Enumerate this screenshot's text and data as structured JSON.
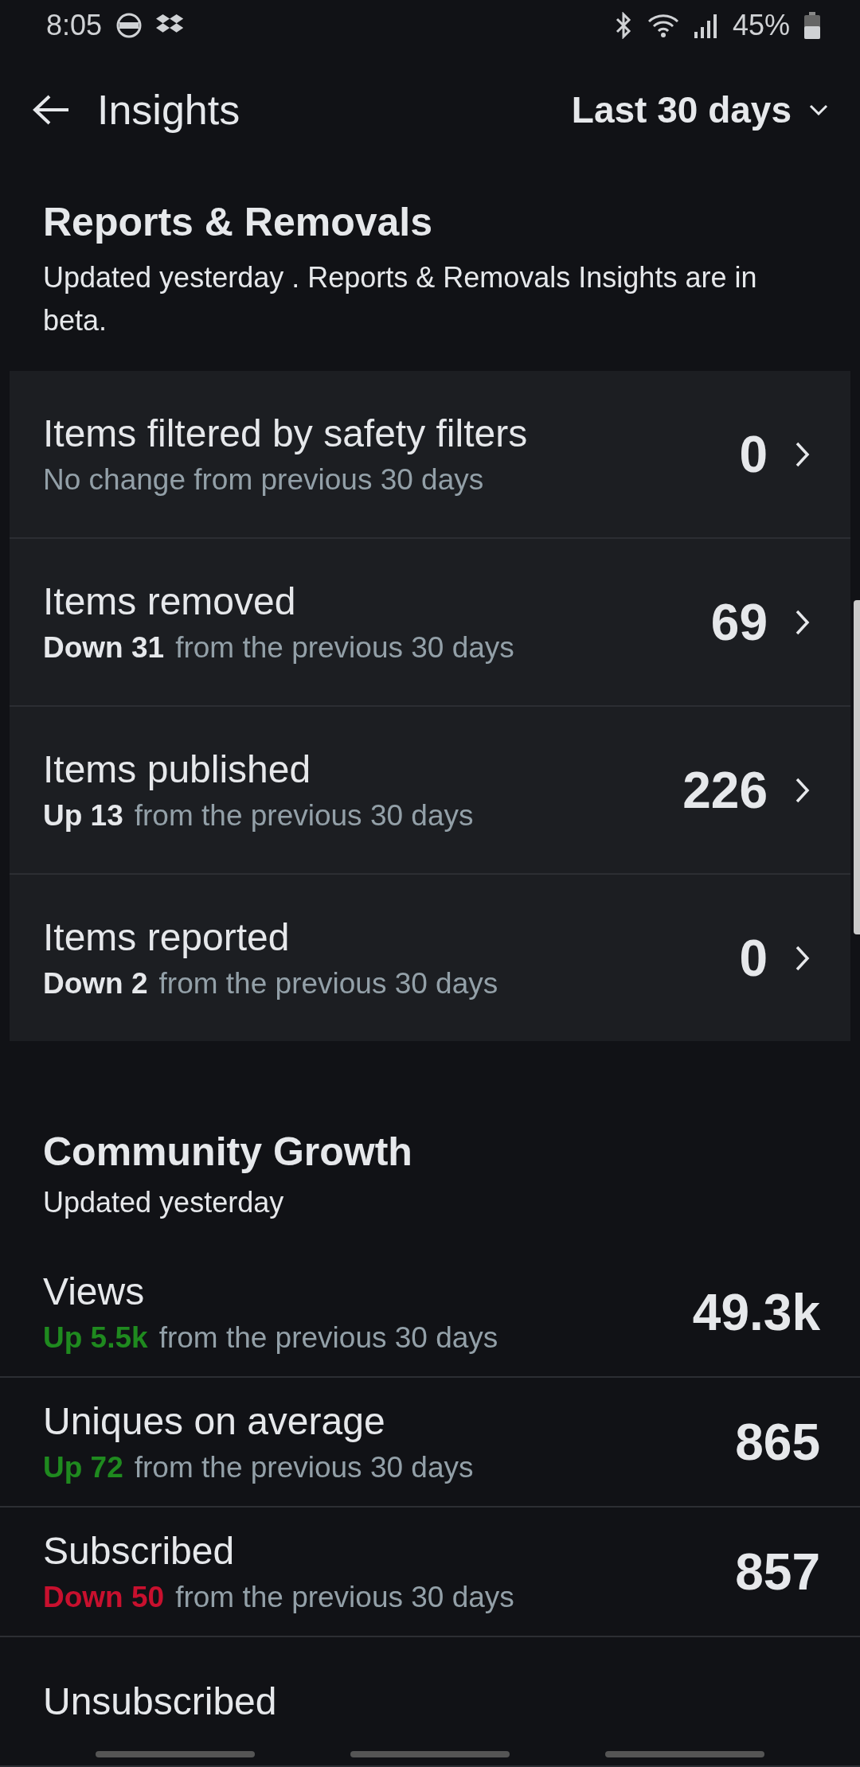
{
  "status_bar": {
    "time": "8:05",
    "battery": "45%"
  },
  "header": {
    "title": "Insights",
    "range": "Last 30 days"
  },
  "reports": {
    "title": "Reports & Removals",
    "subtitle": "Updated yesterday . Reports & Removals Insights are in beta.",
    "rows": [
      {
        "label": "Items filtered by safety filters",
        "note": "No change from previous 30 days",
        "value": "0"
      },
      {
        "label": "Items removed",
        "delta": "Down 31",
        "note": "from the previous 30 days",
        "value": "69"
      },
      {
        "label": "Items published",
        "delta": "Up 13",
        "note": "from the previous 30 days",
        "value": "226"
      },
      {
        "label": "Items reported",
        "delta": "Down 2",
        "note": "from the previous 30 days",
        "value": "0"
      }
    ]
  },
  "growth": {
    "title": "Community Growth",
    "subtitle": "Updated yesterday",
    "rows": [
      {
        "label": "Views",
        "delta": "Up 5.5k",
        "color": "#1f8a1f",
        "note": "from the previous 30 days",
        "value": "49.3k"
      },
      {
        "label": "Uniques on average",
        "delta": "Up 72",
        "color": "#1f8a1f",
        "note": "from the previous 30 days",
        "value": "865"
      },
      {
        "label": "Subscribed",
        "delta": "Down 50",
        "color": "#c8102e",
        "note": "from the previous 30 days",
        "value": "857"
      },
      {
        "label": "Unsubscribed"
      }
    ]
  }
}
